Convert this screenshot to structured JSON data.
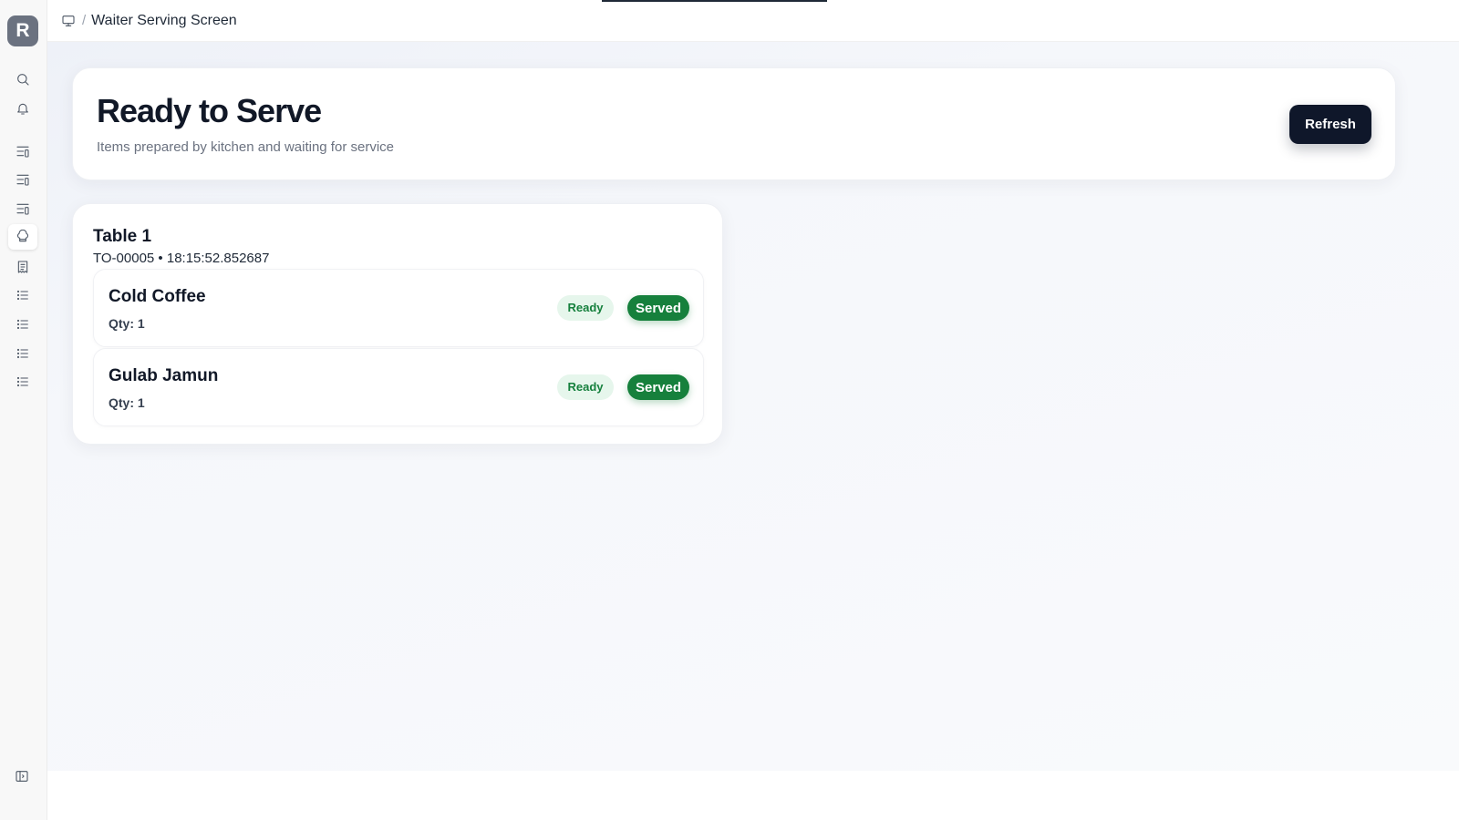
{
  "app": {
    "logo_letter": "R"
  },
  "sidebar": {
    "items": [
      {
        "icon": "search-icon"
      },
      {
        "icon": "bell-icon"
      },
      {
        "icon": "list-filter-icon"
      },
      {
        "icon": "list-filter-icon"
      },
      {
        "icon": "list-filter-icon"
      },
      {
        "icon": "chef-hat-icon",
        "active": true
      },
      {
        "icon": "receipt-icon"
      },
      {
        "icon": "list-icon"
      },
      {
        "icon": "list-icon"
      },
      {
        "icon": "list-icon"
      },
      {
        "icon": "list-icon"
      }
    ],
    "toggle_icon": "sidebar-toggle-icon"
  },
  "breadcrumb": {
    "icon": "monitor-icon",
    "separator": "/",
    "title": "Waiter Serving Screen"
  },
  "header": {
    "title": "Ready to Serve",
    "subtitle": "Items prepared by kitchen and waiting for service",
    "refresh_label": "Refresh"
  },
  "tables": [
    {
      "title": "Table 1",
      "meta": "TO-00005 • 18:15:52.852687",
      "items": [
        {
          "name": "Cold Coffee",
          "qty": "Qty: 1",
          "status": "Ready",
          "action": "Served"
        },
        {
          "name": "Gulab Jamun",
          "qty": "Qty: 1",
          "status": "Ready",
          "action": "Served"
        }
      ]
    }
  ],
  "colors": {
    "accent_dark": "#0f172a",
    "served_green": "#16803c",
    "ready_badge_bg": "#e6f6ec",
    "ready_badge_text": "#15803d"
  }
}
